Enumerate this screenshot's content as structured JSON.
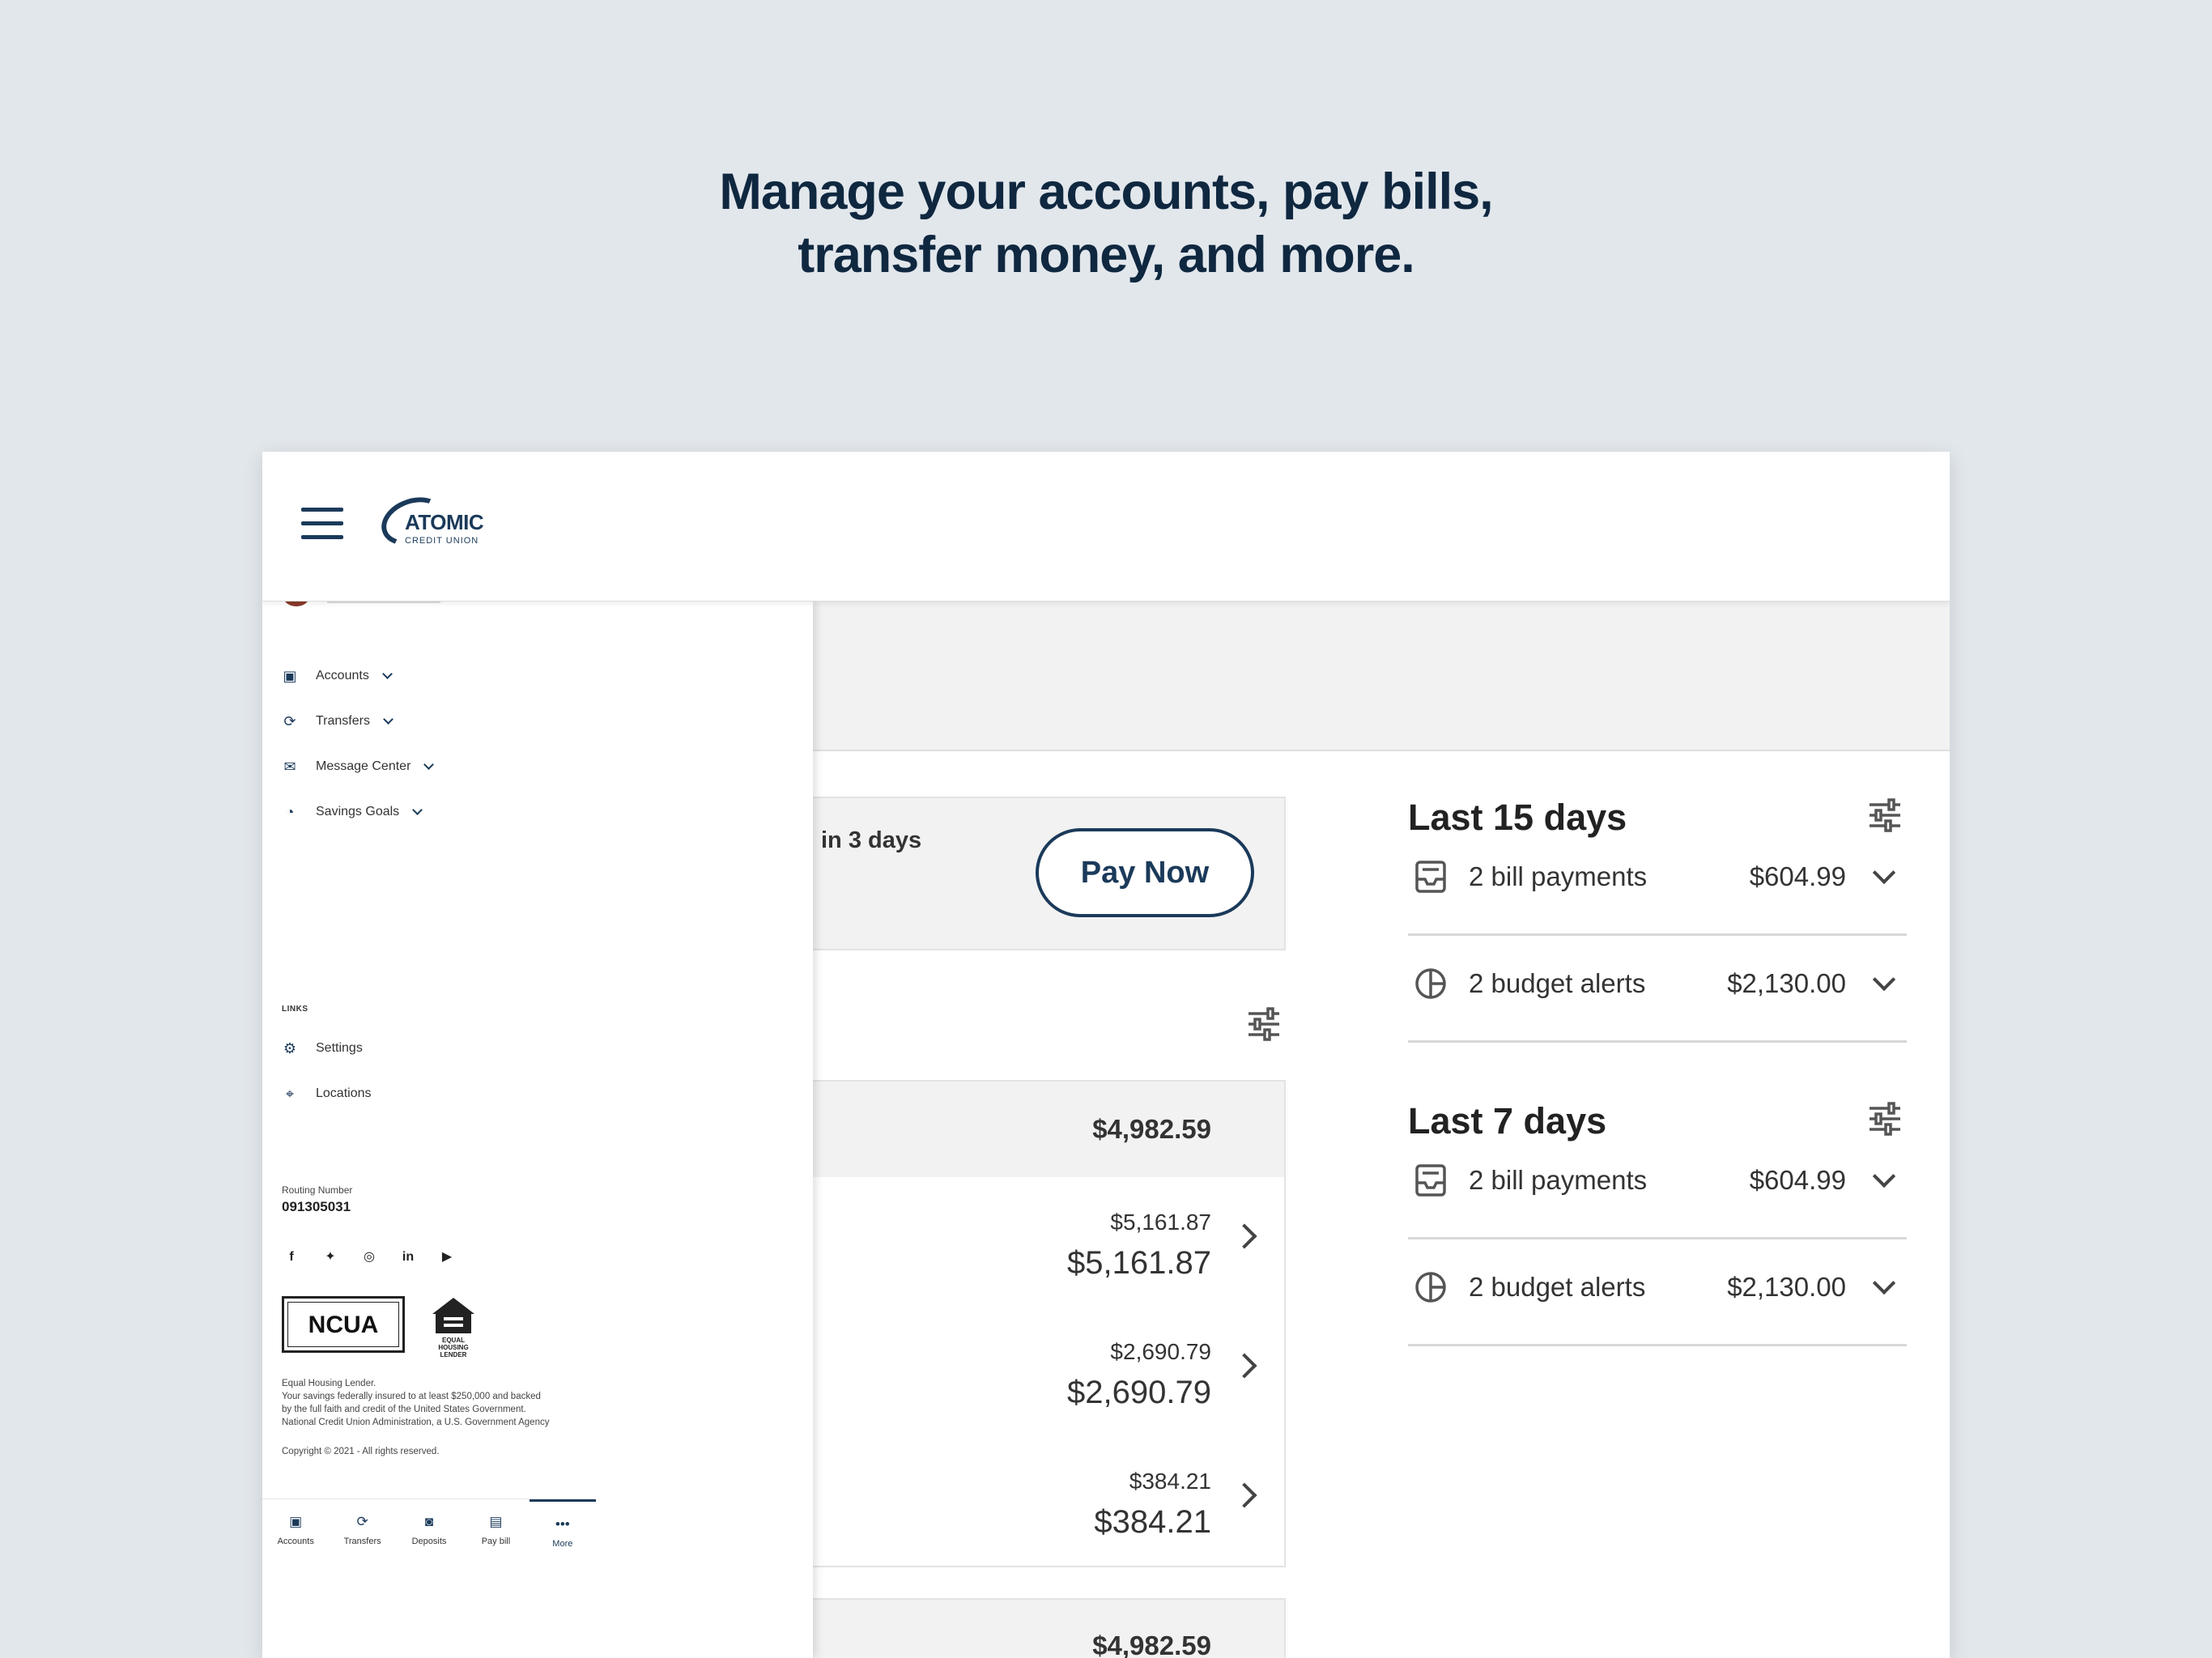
{
  "headline": {
    "line1": "Manage your accounts, pay bills,",
    "line2": "transfer money, and more."
  },
  "brand": {
    "name": "ATOMIC",
    "sub": "CREDIT UNION",
    "primary_color": "#1b3a5a",
    "background_color": "#e2e7ec"
  },
  "main": {
    "bill_due_text": "in 3 days",
    "pay_now_label": "Pay Now",
    "account_group_total": "$4,982.59",
    "accounts": [
      {
        "amount_small": "$5,161.87",
        "amount_large": "$5,161.87"
      },
      {
        "amount_small": "$2,690.79",
        "amount_large": "$2,690.79"
      },
      {
        "amount_small": "$384.21",
        "amount_large": "$384.21"
      }
    ],
    "second_group_total": "$4,982.59"
  },
  "insights": [
    {
      "title": "Last 15 days",
      "rows": [
        {
          "label": "2 bill payments",
          "amount": "$604.99",
          "icon": "bill-icon"
        },
        {
          "label": "2 budget alerts",
          "amount": "$2,130.00",
          "icon": "pie-chart-icon"
        }
      ]
    },
    {
      "title": "Last 7 days",
      "rows": [
        {
          "label": "2 bill payments",
          "amount": "$604.99",
          "icon": "bill-icon"
        },
        {
          "label": "2 budget alerts",
          "amount": "$2,130.00",
          "icon": "pie-chart-icon"
        }
      ]
    }
  ],
  "drawer": {
    "nav": [
      {
        "label": "Accounts",
        "icon": "wallet-icon"
      },
      {
        "label": "Transfers",
        "icon": "transfer-icon"
      },
      {
        "label": "Message Center",
        "icon": "mail-icon"
      },
      {
        "label": "Savings Goals",
        "icon": "piggy-bank-icon"
      }
    ],
    "links_heading": "LINKS",
    "links": [
      {
        "label": "Settings",
        "icon": "gear-icon"
      },
      {
        "label": "Locations",
        "icon": "location-pin-icon"
      }
    ],
    "routing_label": "Routing Number",
    "routing_number": "091305031",
    "ncua_label": "NCUA",
    "ehl_label": "EQUAL HOUSING LENDER",
    "legal": [
      "Equal Housing Lender.",
      "Your savings federally insured to at least $250,000 and backed",
      "by the full faith and credit of the United States Government.",
      "National Credit Union Administration, a U.S. Government Agency"
    ],
    "copyright": "Copyright © 2021 - All rights reserved."
  },
  "bottom_nav": [
    {
      "label": "Accounts",
      "icon": "wallet-icon"
    },
    {
      "label": "Transfers",
      "icon": "transfer-icon"
    },
    {
      "label": "Deposits",
      "icon": "camera-icon"
    },
    {
      "label": "Pay bill",
      "icon": "bill-icon"
    },
    {
      "label": "More",
      "icon": "more-dots-icon",
      "active": true
    }
  ]
}
